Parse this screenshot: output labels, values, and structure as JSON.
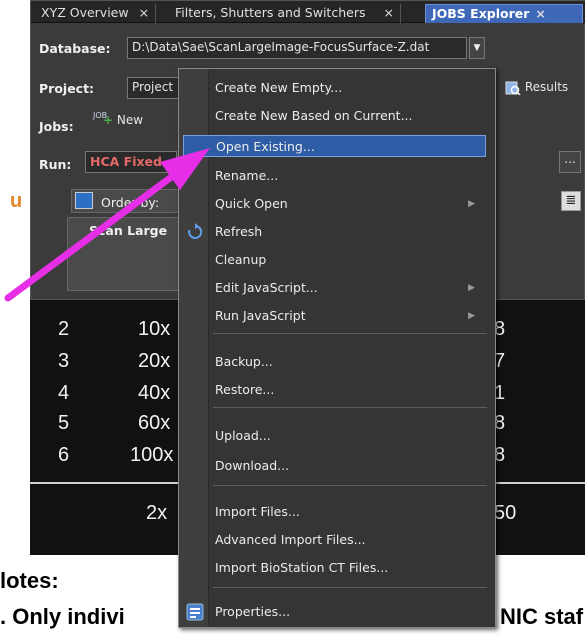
{
  "tabs": [
    {
      "label": "XYZ Overview",
      "close": "×"
    },
    {
      "label": "Filters, Shutters and Switchers",
      "close": "×"
    },
    {
      "label": "JOBS Explorer",
      "close": "×"
    }
  ],
  "database": {
    "label": "Database:",
    "value": "D:\\Data\\Sae\\ScanLargeImage-FocusSurface-Z.dat"
  },
  "project": {
    "label": "Project:",
    "value": "Project",
    "results_label": "Results"
  },
  "jobs": {
    "label": "Jobs:",
    "new_label": "New",
    "icon_text": "JOB"
  },
  "run": {
    "label": "Run:",
    "value": "HCA Fixed",
    "more": "..."
  },
  "order": {
    "label": "Order by:",
    "item": "Scan Large"
  },
  "menu": {
    "items": [
      {
        "label": "Create New Empty..."
      },
      {
        "label": "Create New Based on Current..."
      },
      {
        "label": "Open Existing..."
      },
      {
        "label": "Rename..."
      },
      {
        "label": "Quick Open",
        "sub": "▶"
      },
      {
        "label": "Refresh"
      },
      {
        "label": "Cleanup"
      },
      {
        "label": "Edit JavaScript...",
        "sub": "▶"
      },
      {
        "label": "Run JavaScript",
        "sub": "▶"
      },
      {
        "label": "Backup..."
      },
      {
        "label": "Restore..."
      },
      {
        "label": "Upload..."
      },
      {
        "label": "Download..."
      },
      {
        "label": "Import Files..."
      },
      {
        "label": "Advanced Import Files..."
      },
      {
        "label": "Import BioStation CT Files..."
      },
      {
        "label": "Properties..."
      }
    ]
  },
  "background": {
    "orange_letter": "u",
    "rows": [
      {
        "n": "2",
        "mag": "10x",
        "end": "8"
      },
      {
        "n": "3",
        "mag": "20x",
        "end": "7"
      },
      {
        "n": "4",
        "mag": "40x",
        "end": "1"
      },
      {
        "n": "5",
        "mag": "60x",
        "end": "8"
      },
      {
        "n": "6",
        "mag": "100x",
        "end": "8"
      }
    ],
    "total_row": {
      "mag": "2x",
      "end": "50"
    },
    "notes_heading": "lotes:",
    "notes_line_left": ". Only indivi",
    "notes_line_right": "NIC staf"
  },
  "colors": {
    "accent": "#3f68b8",
    "highlight": "#2f5da5",
    "arrow": "#e62ee6",
    "run_text": "#e46a6a"
  }
}
